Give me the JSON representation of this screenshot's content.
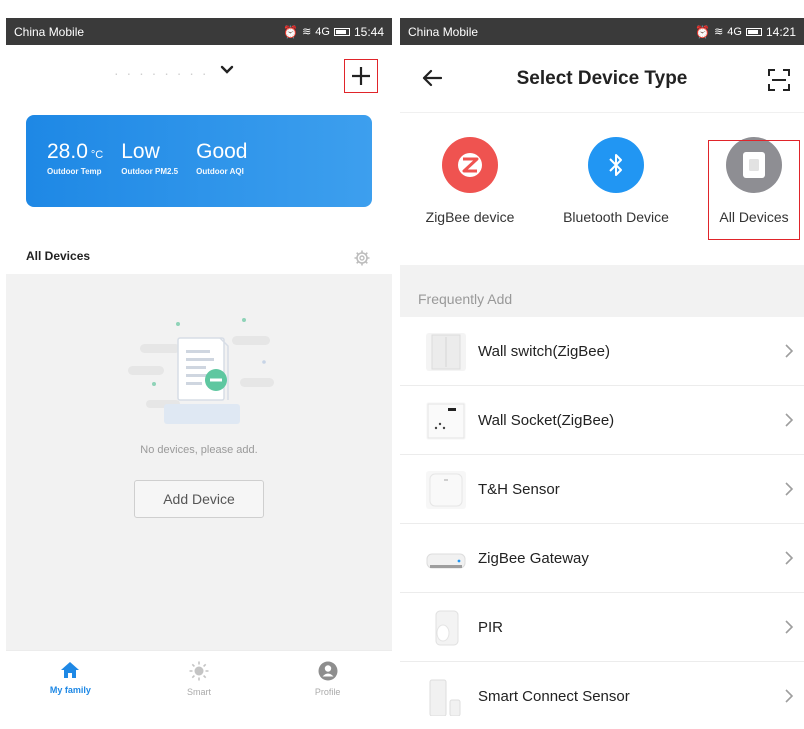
{
  "left_phone": {
    "status": {
      "carrier": "China Mobile",
      "time": "15:44",
      "net": "4G"
    },
    "header": {
      "family_name": "· · · · · · · ·"
    },
    "weather": [
      {
        "value": "28.0",
        "unit": "°C",
        "label": "Outdoor Temp"
      },
      {
        "value": "Low",
        "unit": "",
        "label": "Outdoor PM2.5"
      },
      {
        "value": "Good",
        "unit": "",
        "label": "Outdoor AQI"
      }
    ],
    "tab": {
      "all_devices": "All Devices"
    },
    "empty": {
      "message": "No devices, please add.",
      "add_button": "Add Device"
    },
    "nav": {
      "my_family": "My family",
      "smart": "Smart",
      "profile": "Profile"
    },
    "colors": {
      "accent": "#1e88e5",
      "highlight": "#e0242a"
    }
  },
  "right_phone": {
    "status": {
      "carrier": "China Mobile",
      "time": "14:21",
      "net": "4G"
    },
    "header": {
      "title": "Select Device Type"
    },
    "types": [
      {
        "label": "ZigBee device",
        "icon": "zigbee-icon",
        "color": "#ef5350"
      },
      {
        "label": "Bluetooth Device",
        "icon": "bluetooth-icon",
        "color": "#2196f3"
      },
      {
        "label": "All Devices",
        "icon": "all-devices-icon",
        "color": "#8e8e93"
      }
    ],
    "frequently_add": "Frequently Add",
    "devices": [
      {
        "name": "Wall switch(ZigBee)"
      },
      {
        "name": "Wall Socket(ZigBee)"
      },
      {
        "name": "T&H Sensor"
      },
      {
        "name": "ZigBee Gateway"
      },
      {
        "name": "PIR"
      },
      {
        "name": "Smart Connect Sensor"
      }
    ]
  }
}
